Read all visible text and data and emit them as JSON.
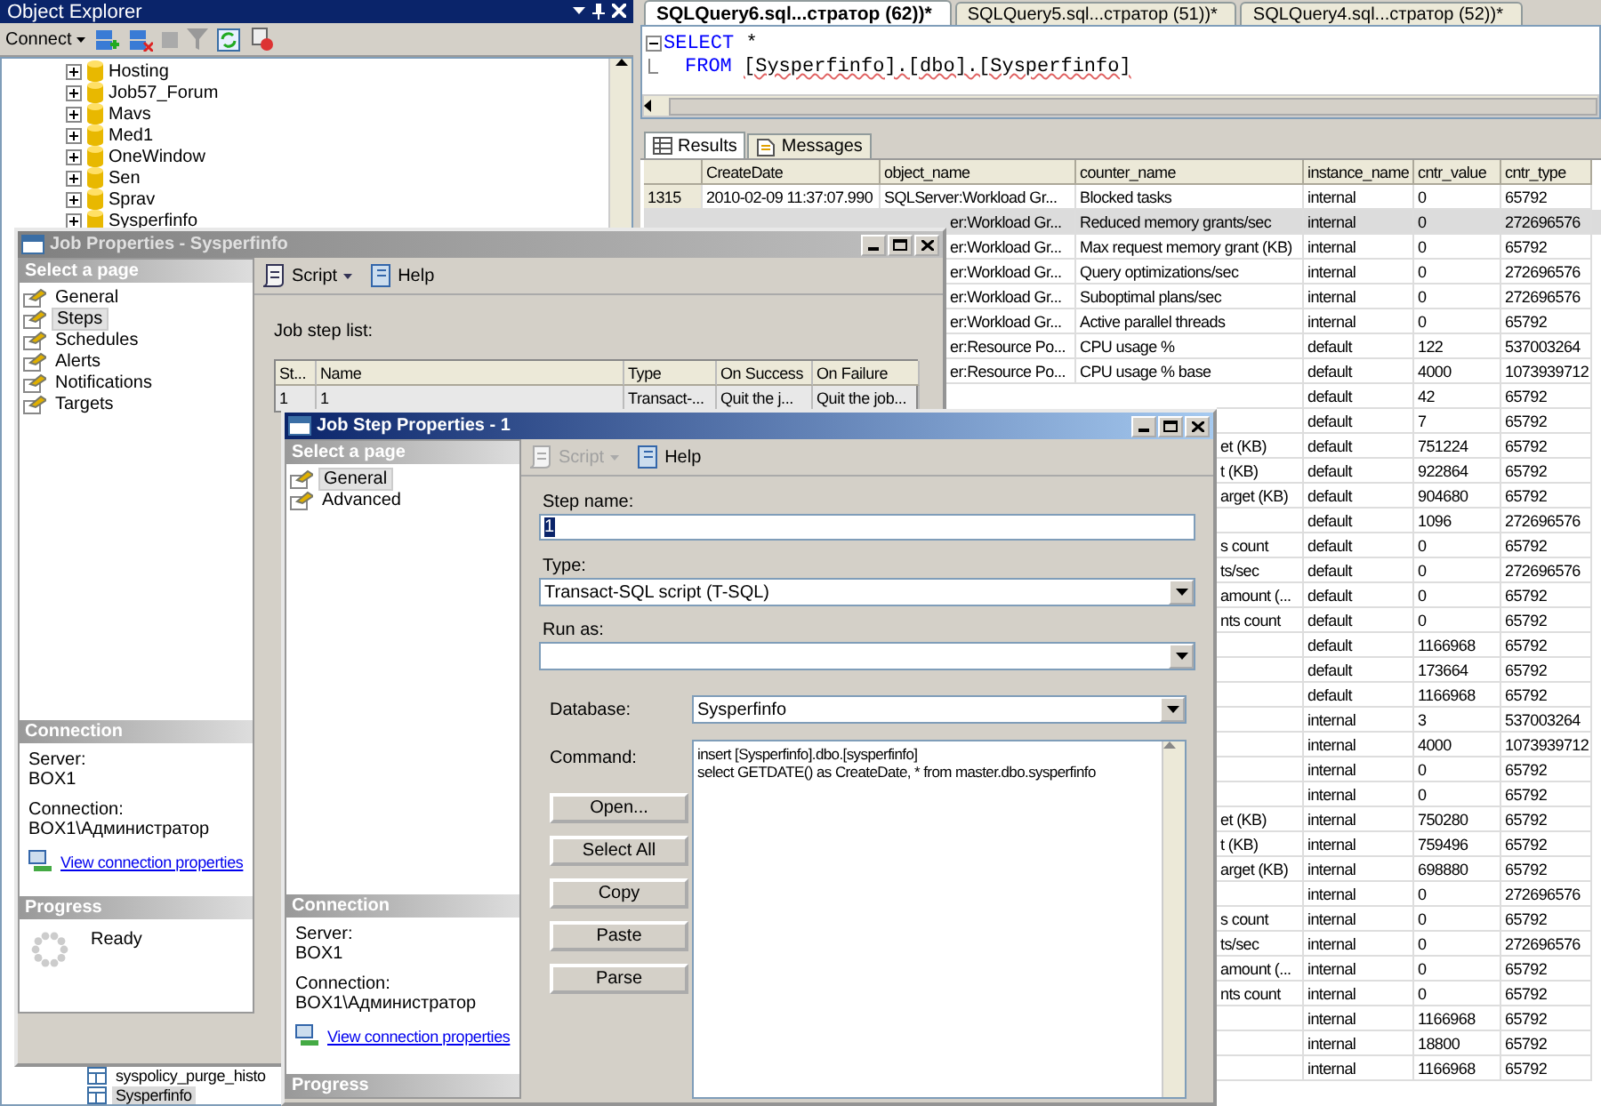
{
  "object_explorer": {
    "title": "Object Explorer",
    "connect_label": "Connect",
    "tree_items": [
      {
        "label": "Hosting",
        "expanded": false
      },
      {
        "label": "Job57_Forum",
        "expanded": false
      },
      {
        "label": "Mavs",
        "expanded": false
      },
      {
        "label": "Med1",
        "expanded": false
      },
      {
        "label": "OneWindow",
        "expanded": false
      },
      {
        "label": "Sen",
        "expanded": false
      },
      {
        "label": "Sprav",
        "expanded": false
      },
      {
        "label": "Sysperfinfo",
        "expanded": false
      }
    ],
    "bottom_items": [
      {
        "label": "syspolicy_purge_histo",
        "selected": false
      },
      {
        "label": "Sysperfinfo",
        "selected": true
      }
    ]
  },
  "query_tabs": [
    {
      "label": "SQLQuery6.sql...стратор (62))*",
      "selected": true
    },
    {
      "label": "SQLQuery5.sql...стратор (51))*",
      "selected": false
    },
    {
      "label": "SQLQuery4.sql...стратор (52))*",
      "selected": false
    }
  ],
  "editor": {
    "lines": [
      {
        "kind": "start",
        "tokens": [
          {
            "text": "SELECT",
            "kind": "keyword"
          },
          {
            "text": " *",
            "kind": "plain"
          }
        ]
      },
      {
        "kind": "continuation",
        "tokens": [
          {
            "text": "FROM",
            "kind": "keyword"
          },
          {
            "text": "[Sysperfinfo].[dbo].[Sysperfinfo]",
            "kind": "identifier"
          }
        ]
      }
    ]
  },
  "results_tabs": [
    {
      "label": "Results",
      "selected": true
    },
    {
      "label": "Messages",
      "selected": false
    }
  ],
  "results_grid": {
    "columns": [
      "CreateDate",
      "object_name",
      "counter_name",
      "instance_name",
      "cntr_value",
      "cntr_type"
    ],
    "rows": [
      {
        "kind": "full",
        "selected": false,
        "row_number": "1315",
        "create_date": "2010-02-09 11:37:07.990",
        "object_name": "SQLServer:Workload Gr...",
        "counter_name": "Blocked tasks",
        "instance_name": "internal",
        "cntr_value": "0",
        "cntr_type": "65792"
      },
      {
        "kind": "partial",
        "selected": true,
        "object_name": "er:Workload Gr...",
        "counter_name": "Reduced memory grants/sec",
        "instance_name": "internal",
        "cntr_value": "0",
        "cntr_type": "272696576"
      },
      {
        "kind": "partial",
        "selected": false,
        "object_name": "er:Workload Gr...",
        "counter_name": "Max request memory grant (KB)",
        "instance_name": "internal",
        "cntr_value": "0",
        "cntr_type": "65792"
      },
      {
        "kind": "partial",
        "selected": false,
        "object_name": "er:Workload Gr...",
        "counter_name": "Query optimizations/sec",
        "instance_name": "internal",
        "cntr_value": "0",
        "cntr_type": "272696576"
      },
      {
        "kind": "partial",
        "selected": false,
        "object_name": "er:Workload Gr...",
        "counter_name": "Suboptimal plans/sec",
        "instance_name": "internal",
        "cntr_value": "0",
        "cntr_type": "272696576"
      },
      {
        "kind": "partial",
        "selected": false,
        "object_name": "er:Workload Gr...",
        "counter_name": "Active parallel threads",
        "instance_name": "internal",
        "cntr_value": "0",
        "cntr_type": "65792"
      },
      {
        "kind": "partial",
        "selected": false,
        "object_name": "er:Resource Po...",
        "counter_name": "CPU usage %",
        "instance_name": "default",
        "cntr_value": "122",
        "cntr_type": "537003264"
      },
      {
        "kind": "partial",
        "selected": false,
        "object_name": "er:Resource Po...",
        "counter_name": "CPU usage % base",
        "instance_name": "default",
        "cntr_value": "4000",
        "cntr_type": "1073939712"
      },
      {
        "kind": "tail",
        "selected": false,
        "instance_name": "default",
        "cntr_value": "42",
        "cntr_type": "65792"
      },
      {
        "kind": "tail",
        "selected": false,
        "instance_name": "default",
        "cntr_value": "7",
        "cntr_type": "65792"
      },
      {
        "kind": "tail",
        "selected": false,
        "counter_name": "et (KB)",
        "instance_name": "default",
        "cntr_value": "751224",
        "cntr_type": "65792"
      },
      {
        "kind": "tail",
        "selected": false,
        "counter_name": "t (KB)",
        "instance_name": "default",
        "cntr_value": "922864",
        "cntr_type": "65792"
      },
      {
        "kind": "tail",
        "selected": false,
        "counter_name": "arget (KB)",
        "instance_name": "default",
        "cntr_value": "904680",
        "cntr_type": "65792"
      },
      {
        "kind": "tail",
        "selected": false,
        "instance_name": "default",
        "cntr_value": "1096",
        "cntr_type": "272696576"
      },
      {
        "kind": "tail",
        "selected": false,
        "counter_name": "s count",
        "instance_name": "default",
        "cntr_value": "0",
        "cntr_type": "65792"
      },
      {
        "kind": "tail",
        "selected": false,
        "counter_name": "ts/sec",
        "instance_name": "default",
        "cntr_value": "0",
        "cntr_type": "272696576"
      },
      {
        "kind": "tail",
        "selected": false,
        "counter_name": "amount (...",
        "instance_name": "default",
        "cntr_value": "0",
        "cntr_type": "65792"
      },
      {
        "kind": "tail",
        "selected": false,
        "counter_name": "nts count",
        "instance_name": "default",
        "cntr_value": "0",
        "cntr_type": "65792"
      },
      {
        "kind": "tail",
        "selected": false,
        "instance_name": "default",
        "cntr_value": "1166968",
        "cntr_type": "65792"
      },
      {
        "kind": "tail",
        "selected": false,
        "instance_name": "default",
        "cntr_value": "173664",
        "cntr_type": "65792"
      },
      {
        "kind": "tail",
        "selected": false,
        "instance_name": "default",
        "cntr_value": "1166968",
        "cntr_type": "65792"
      },
      {
        "kind": "tail",
        "selected": false,
        "instance_name": "internal",
        "cntr_value": "3",
        "cntr_type": "537003264"
      },
      {
        "kind": "tail",
        "selected": false,
        "instance_name": "internal",
        "cntr_value": "4000",
        "cntr_type": "1073939712"
      },
      {
        "kind": "tail",
        "selected": false,
        "instance_name": "internal",
        "cntr_value": "0",
        "cntr_type": "65792"
      },
      {
        "kind": "tail",
        "selected": false,
        "instance_name": "internal",
        "cntr_value": "0",
        "cntr_type": "65792"
      },
      {
        "kind": "tail",
        "selected": false,
        "counter_name": "et (KB)",
        "instance_name": "internal",
        "cntr_value": "750280",
        "cntr_type": "65792"
      },
      {
        "kind": "tail",
        "selected": false,
        "counter_name": "t (KB)",
        "instance_name": "internal",
        "cntr_value": "759496",
        "cntr_type": "65792"
      },
      {
        "kind": "tail",
        "selected": false,
        "counter_name": "arget (KB)",
        "instance_name": "internal",
        "cntr_value": "698880",
        "cntr_type": "65792"
      },
      {
        "kind": "tail",
        "selected": false,
        "instance_name": "internal",
        "cntr_value": "0",
        "cntr_type": "272696576"
      },
      {
        "kind": "tail",
        "selected": false,
        "counter_name": "s count",
        "instance_name": "internal",
        "cntr_value": "0",
        "cntr_type": "65792"
      },
      {
        "kind": "tail",
        "selected": false,
        "counter_name": "ts/sec",
        "instance_name": "internal",
        "cntr_value": "0",
        "cntr_type": "272696576"
      },
      {
        "kind": "tail",
        "selected": false,
        "counter_name": "amount (...",
        "instance_name": "internal",
        "cntr_value": "0",
        "cntr_type": "65792"
      },
      {
        "kind": "tail",
        "selected": false,
        "counter_name": "nts count",
        "instance_name": "internal",
        "cntr_value": "0",
        "cntr_type": "65792"
      },
      {
        "kind": "tail",
        "selected": false,
        "instance_name": "internal",
        "cntr_value": "1166968",
        "cntr_type": "65792"
      },
      {
        "kind": "tail",
        "selected": false,
        "instance_name": "internal",
        "cntr_value": "18800",
        "cntr_type": "65792"
      },
      {
        "kind": "tail",
        "selected": false,
        "instance_name": "internal",
        "cntr_value": "1166968",
        "cntr_type": "65792"
      }
    ]
  },
  "job_properties": {
    "title": "Job Properties - Sysperfinfo",
    "active": false,
    "select_page_header": "Select a page",
    "pages": [
      {
        "label": "General",
        "selected": false
      },
      {
        "label": "Steps",
        "selected": true
      },
      {
        "label": "Schedules",
        "selected": false
      },
      {
        "label": "Alerts",
        "selected": false
      },
      {
        "label": "Notifications",
        "selected": false
      },
      {
        "label": "Targets",
        "selected": false
      }
    ],
    "toolbar": [
      {
        "kind": "script",
        "label": "Script",
        "disabled": false
      },
      {
        "kind": "help",
        "label": "Help",
        "disabled": false
      }
    ],
    "connection_header": "Connection",
    "server_label": "Server:",
    "server": "BOX1",
    "connection_label": "Connection:",
    "connection": "BOX1\\Администратор",
    "link": "View connection properties",
    "progress_header": "Progress",
    "progress_status": "Ready",
    "step_list_label": "Job step list:",
    "step_columns": [
      "St...",
      "Name",
      "Type",
      "On Success",
      "On Failure"
    ],
    "step_rows": [
      [
        "1",
        "1",
        "Transact-...",
        "Quit the j...",
        "Quit the job..."
      ]
    ]
  },
  "job_step_properties": {
    "title": "Job Step Properties - 1",
    "active": true,
    "select_page_header": "Select a page",
    "pages": [
      {
        "label": "General",
        "selected": true
      },
      {
        "label": "Advanced",
        "selected": false
      }
    ],
    "toolbar": [
      {
        "kind": "script",
        "label": "Script",
        "disabled": true
      },
      {
        "kind": "help",
        "label": "Help",
        "disabled": false
      }
    ],
    "connection_header": "Connection",
    "server_label": "Server:",
    "server": "BOX1",
    "connection_label": "Connection:",
    "connection": "BOX1\\Администратор",
    "link": "View connection properties",
    "progress_header": "Progress",
    "step_name_label": "Step name:",
    "step_name": "1",
    "step_name_selected": true,
    "type_label": "Type:",
    "type": "Transact-SQL script (T-SQL)",
    "run_as_label": "Run as:",
    "database_label": "Database:",
    "database": "Sysperfinfo",
    "command_label": "Command:",
    "command_lines": [
      "insert [Sysperfinfo].dbo.[sysperfinfo]",
      "select GETDATE() as CreateDate, * from master.dbo.sysperfinfo"
    ],
    "buttons": [
      "Open...",
      "Select All",
      "Copy",
      "Paste",
      "Parse"
    ]
  }
}
